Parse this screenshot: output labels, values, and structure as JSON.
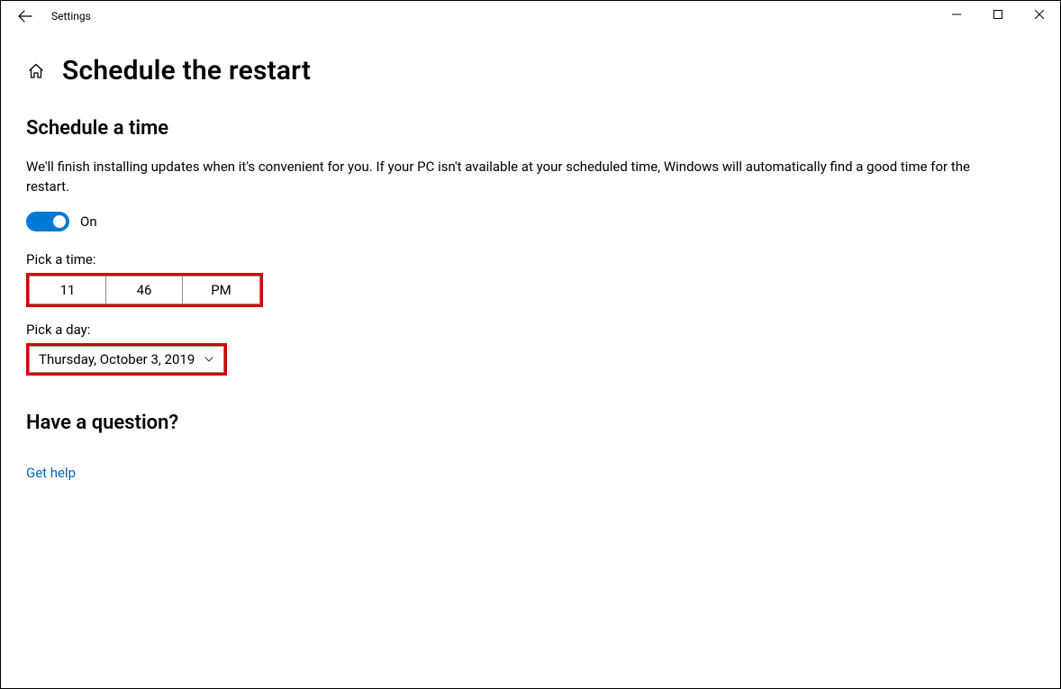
{
  "window": {
    "title": "Settings"
  },
  "page": {
    "title": "Schedule the restart"
  },
  "section1": {
    "heading": "Schedule a time",
    "description": "We'll finish installing updates when it's convenient for you. If your PC isn't available at your scheduled time, Windows will automatically find a good time for the restart.",
    "toggle_state_label": "On",
    "pick_time_label": "Pick a time:",
    "time": {
      "hour": "11",
      "minute": "46",
      "period": "PM"
    },
    "pick_day_label": "Pick a day:",
    "day": "Thursday, October 3, 2019"
  },
  "help": {
    "heading": "Have a question?",
    "link": "Get help"
  }
}
